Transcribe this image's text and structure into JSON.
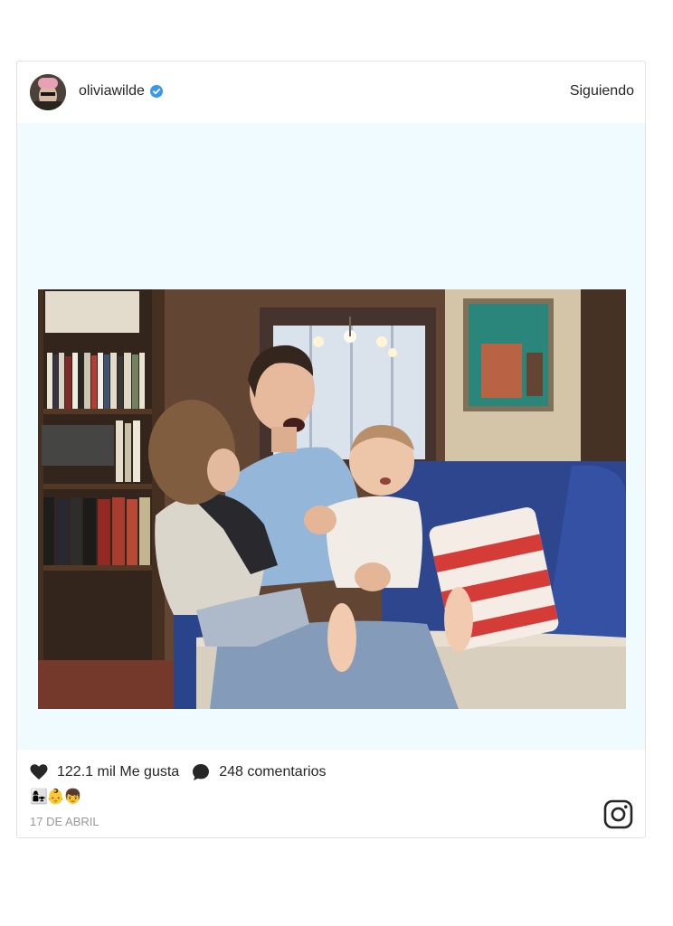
{
  "post": {
    "username": "oliviawilde",
    "verified_icon": "verified-badge-icon",
    "follow_label": "Siguiendo",
    "likes_label": "122.1 mil Me gusta",
    "comments_label": "248 comentarios",
    "caption": "👩‍👧👶👦",
    "date": "17 DE ABRIL"
  },
  "icons": {
    "like": "heart-icon",
    "comment": "comment-bubble-icon",
    "brand": "instagram-logo-icon"
  },
  "colors": {
    "media_background": "#f0fbff",
    "verified": "#3897f0",
    "text": "#262626",
    "muted": "#999999"
  }
}
